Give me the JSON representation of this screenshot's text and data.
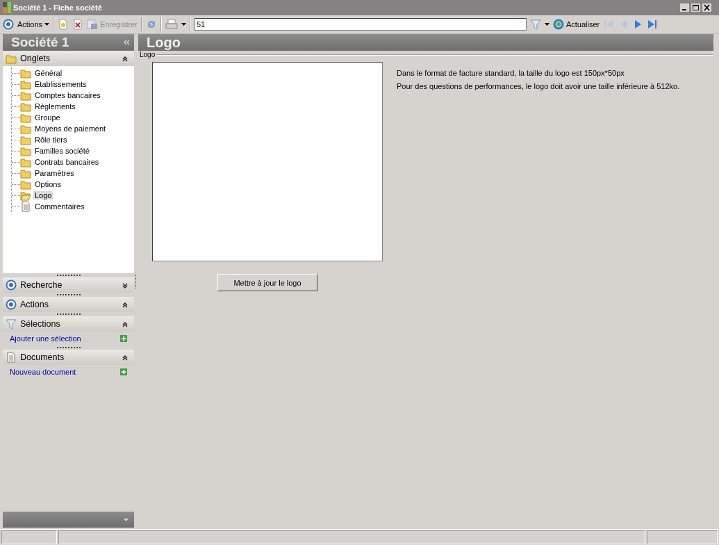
{
  "window": {
    "title": "Société 1 - Fiche société"
  },
  "toolbar": {
    "actions": "Actions",
    "save": {
      "label": "Enregistrer",
      "disabled": true
    },
    "search": {
      "value": "51"
    },
    "refresh": "Actualiser",
    "nav": [
      {
        "kind": "first",
        "disabled": true
      },
      {
        "kind": "prev",
        "disabled": true
      },
      {
        "kind": "next",
        "disabled": false
      },
      {
        "kind": "last",
        "disabled": false
      }
    ]
  },
  "sidebar": {
    "title": "Société 1",
    "sections": [
      {
        "title": "Onglets",
        "kind": "folder",
        "expanded": true,
        "items": [
          {
            "label": "Général",
            "kind": "folder",
            "selected": false
          },
          {
            "label": "Etablissements",
            "kind": "folder",
            "selected": false
          },
          {
            "label": "Comptes bancaires",
            "kind": "folder",
            "selected": false
          },
          {
            "label": "Règlements",
            "kind": "folder",
            "selected": false
          },
          {
            "label": "Groupe",
            "kind": "folder",
            "selected": false
          },
          {
            "label": "Moyens de paiement",
            "kind": "folder",
            "selected": false
          },
          {
            "label": "Rôle tiers",
            "kind": "folder",
            "selected": false
          },
          {
            "label": "Familles société",
            "kind": "folder",
            "selected": false
          },
          {
            "label": "Contrats bancaires",
            "kind": "folder",
            "selected": false
          },
          {
            "label": "Paramètres",
            "kind": "folder",
            "selected": false
          },
          {
            "label": "Options",
            "kind": "folder",
            "selected": false
          },
          {
            "label": "Logo",
            "kind": "open-folder",
            "selected": true
          },
          {
            "label": "Commentaires",
            "kind": "document",
            "selected": false
          }
        ]
      },
      {
        "title": "Recherche",
        "kind": "radio",
        "expanded": false
      },
      {
        "title": "Actions",
        "kind": "radio",
        "expanded": true
      },
      {
        "title": "Sélections",
        "kind": "filter",
        "expanded": true,
        "links": [
          "Ajouter une sélection"
        ]
      },
      {
        "title": "Documents",
        "kind": "document",
        "expanded": true,
        "links": [
          "Nouveau document"
        ]
      }
    ]
  },
  "content": {
    "title": "Logo",
    "group": "Logo",
    "notes": [
      "Dans le format de facture standard, la taille du logo est 150px*50px",
      "Pour des questions de performances, le logo doit avoir une taille inférieure à 512ko."
    ],
    "button": "Mettre à jour le logo"
  }
}
